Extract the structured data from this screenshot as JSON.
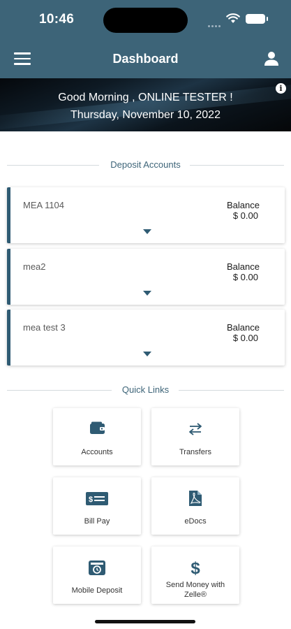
{
  "status_bar": {
    "time": "10:46"
  },
  "nav": {
    "title": "Dashboard"
  },
  "banner": {
    "greeting": "Good Morning , ONLINE TESTER !",
    "date": "Thursday, November 10, 2022",
    "info_icon": "i"
  },
  "deposit_accounts": {
    "header": "Deposit Accounts",
    "accounts": [
      {
        "name": "MEA 1104",
        "balance_label": "Balance",
        "balance": "$ 0.00"
      },
      {
        "name": "mea2",
        "balance_label": "Balance",
        "balance": "$ 0.00"
      },
      {
        "name": "mea test 3",
        "balance_label": "Balance",
        "balance": "$ 0.00"
      }
    ]
  },
  "quick_links": {
    "header": "Quick Links",
    "items": [
      {
        "label": "Accounts",
        "icon": "wallet-icon"
      },
      {
        "label": "Transfers",
        "icon": "transfer-arrows-icon"
      },
      {
        "label": "Bill Pay",
        "icon": "check-icon"
      },
      {
        "label": "eDocs",
        "icon": "pdf-document-icon"
      },
      {
        "label": "Mobile Deposit",
        "icon": "mobile-deposit-icon"
      },
      {
        "label": "Send Money with Zelle®",
        "icon": "dollar-icon"
      }
    ]
  },
  "colors": {
    "brand": "#3d6478",
    "accent": "#2f5b73",
    "divider": "#d4dadd"
  }
}
